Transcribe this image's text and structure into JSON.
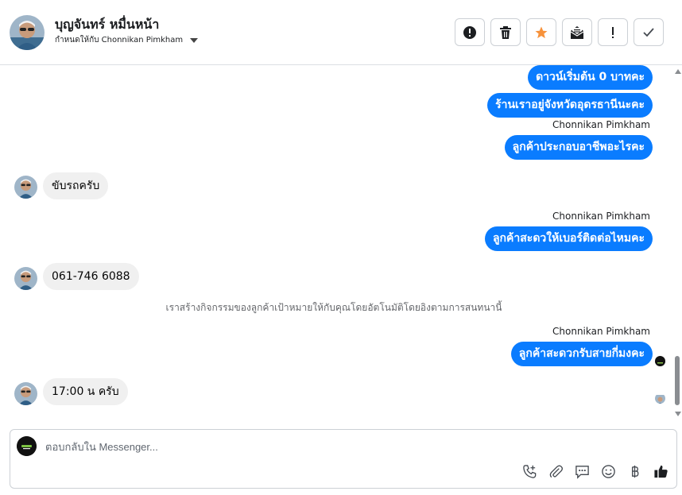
{
  "header": {
    "contact_name": "บุญจันทร์ หมื่นหน้า",
    "assigned_label": "กำหนดให้กับ Chonnikan Pimkham"
  },
  "actions": [
    {
      "name": "spam-button",
      "icon": "exclamation-circle-icon"
    },
    {
      "name": "delete-button",
      "icon": "trash-icon"
    },
    {
      "name": "star-button",
      "icon": "star-icon",
      "color": "#f7923b"
    },
    {
      "name": "mark-unread-button",
      "icon": "envelope-icon"
    },
    {
      "name": "follow-up-button",
      "icon": "exclamation-icon"
    },
    {
      "name": "done-button",
      "icon": "check-icon"
    }
  ],
  "conversation": {
    "out_1": "ดาวน์เริ่มต้น 0 บาทคะ",
    "out_2": "ร้านเราอยู่จังหวัดอุดรธานีนะคะ",
    "sender_1": "Chonnikan Pimkham",
    "out_3": "ลูกค้าประกอบอาชีพอะไรคะ",
    "in_1": "ขับรถครับ",
    "sender_2": "Chonnikan Pimkham",
    "out_4": "ลูกค้าสะดวให้เบอร์ติดต่อไหมคะ",
    "in_2": "061-746 6088",
    "system_note": "เราสร้างกิจกรรมของลูกค้าเป้าหมายให้กับคุณโดยอัตโนมัติโดยอิงตามการสนทนานี้",
    "sender_3": "Chonnikan Pimkham",
    "out_5": "ลูกค้าสะดวกรับสายกี่มงคะ",
    "in_3": "17:00 น ครับ"
  },
  "composer": {
    "placeholder": "ตอบกลับใน Messenger...",
    "tools": [
      "phone-plus-icon",
      "paperclip-icon",
      "saved-reply-icon",
      "emoji-icon",
      "baht-icon",
      "thumbs-up-icon"
    ]
  },
  "colors": {
    "outgoing_bubble": "#0a7cff",
    "incoming_bubble": "#f0f0f0",
    "star": "#f7923b"
  }
}
